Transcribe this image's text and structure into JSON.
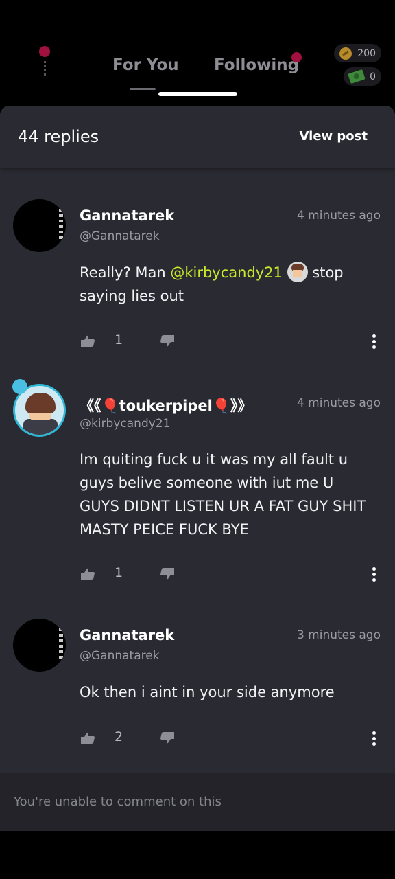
{
  "nav": {
    "tabs": [
      {
        "label": "For You"
      },
      {
        "label": "Following"
      }
    ],
    "coins": "200",
    "cash": "0"
  },
  "sheet": {
    "replies_count": "44 replies",
    "view_post": "View post"
  },
  "comments": [
    {
      "username": "Gannatarek",
      "handle": "@Gannatarek",
      "timestamp": "4 minutes ago",
      "text_before": "Really? Man ",
      "mention": "@kirbycandy21",
      "text_after": " stop saying lies out",
      "likes": "1"
    },
    {
      "username": "《《🎈toukerpipel🎈》》",
      "handle": "@kirbycandy21",
      "timestamp": "4 minutes ago",
      "text": "Im quiting fuck u it was my all fault u guys belive someone with iut me U GUYS DIDNT LISTEN UR A FAT GUY SHIT MASTY PEICE FUCK BYE",
      "likes": "1"
    },
    {
      "username": "Gannatarek",
      "handle": "@Gannatarek",
      "timestamp": "3 minutes ago",
      "text": "Ok then i aint in your side anymore",
      "likes": "2"
    }
  ],
  "footer": {
    "text": "You're unable to comment on this"
  },
  "colors": {
    "accent_mention": "#c9ea2a",
    "notification_dot": "#a0113f",
    "sheet_bg": "#2a2a32"
  },
  "icons": [
    "menu-icon",
    "coin-icon",
    "cash-icon",
    "thumbs-up-icon",
    "thumbs-down-icon",
    "more-vertical-icon"
  ]
}
